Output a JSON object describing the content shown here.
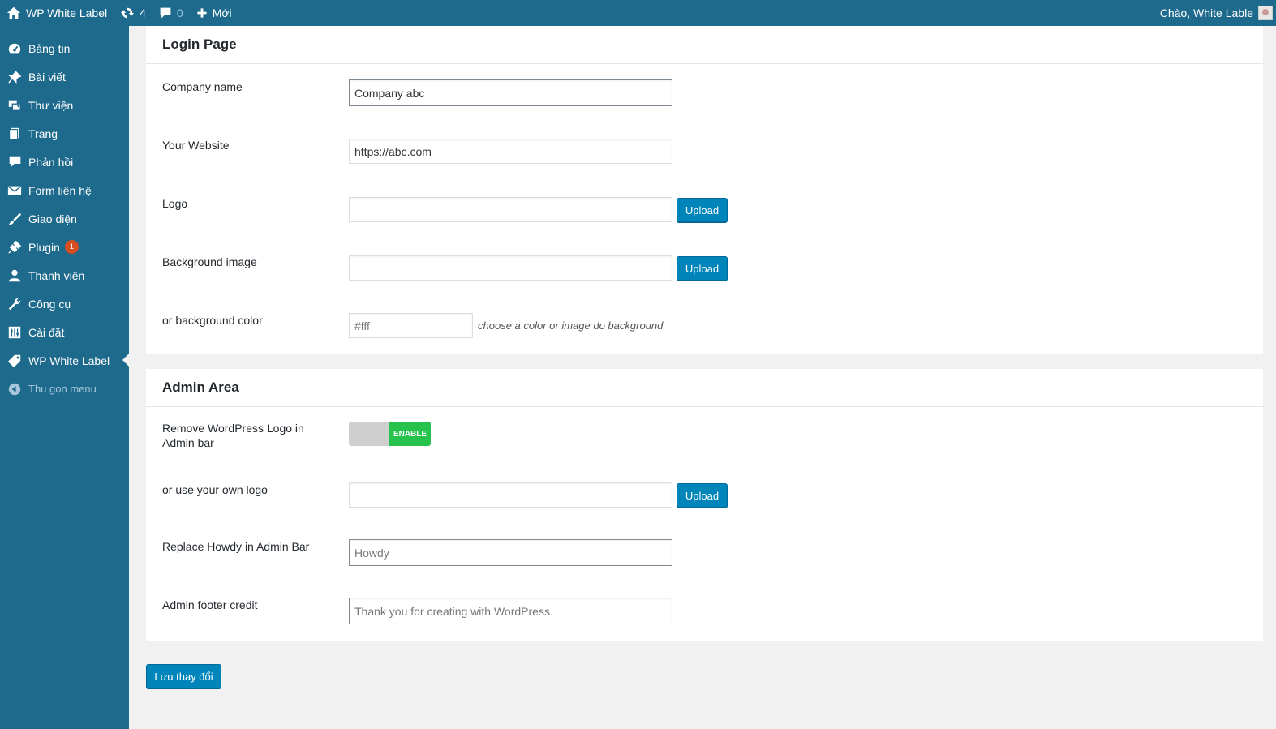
{
  "adminbar": {
    "site_name": "WP White Label",
    "updates_count": "4",
    "comments_count": "0",
    "new_label": "Mới",
    "greeting": "Chào, White Lable"
  },
  "sidebar": {
    "items": [
      {
        "label": "Bảng tin",
        "icon": "dashboard-icon"
      },
      {
        "label": "Bài viết",
        "icon": "pin-icon"
      },
      {
        "label": "Thư viện",
        "icon": "media-icon"
      },
      {
        "label": "Trang",
        "icon": "page-icon"
      },
      {
        "label": "Phản hồi",
        "icon": "comment-icon"
      },
      {
        "label": "Form liên hệ",
        "icon": "mail-icon"
      },
      {
        "label": "Giao diện",
        "icon": "brush-icon"
      },
      {
        "label": "Plugin",
        "icon": "plugin-icon",
        "badge": "1"
      },
      {
        "label": "Thành viên",
        "icon": "user-icon"
      },
      {
        "label": "Công cụ",
        "icon": "wrench-icon"
      },
      {
        "label": "Cài đặt",
        "icon": "settings-icon"
      },
      {
        "label": "WP White Label",
        "icon": "tag-icon"
      }
    ],
    "collapse_label": "Thu gọn menu"
  },
  "login_page": {
    "title": "Login Page",
    "company_name_label": "Company name",
    "company_name_value": "Company abc",
    "website_label": "Your Website",
    "website_value": "https://abc.com",
    "logo_label": "Logo",
    "logo_value": "",
    "background_image_label": "Background image",
    "background_image_value": "",
    "background_color_label": "or background color",
    "background_color_placeholder": "#fff",
    "background_color_hint": "choose a color or image do background",
    "upload_label": "Upload"
  },
  "admin_area": {
    "title": "Admin Area",
    "remove_logo_label": "Remove WordPress Logo in Admin bar",
    "toggle_label": "ENABLE",
    "own_logo_label": "or use your own logo",
    "own_logo_value": "",
    "replace_howdy_label": "Replace Howdy in Admin Bar",
    "replace_howdy_placeholder": "Howdy",
    "footer_credit_label": "Admin footer credit",
    "footer_credit_placeholder": "Thank you for creating with WordPress.",
    "upload_label": "Upload"
  },
  "save_button_label": "Lưu thay đổi",
  "colors": {
    "adminbar_bg": "#1e6a8d",
    "primary_button": "#0085ba",
    "toggle_on": "#27c24c",
    "badge": "#d54e21"
  }
}
